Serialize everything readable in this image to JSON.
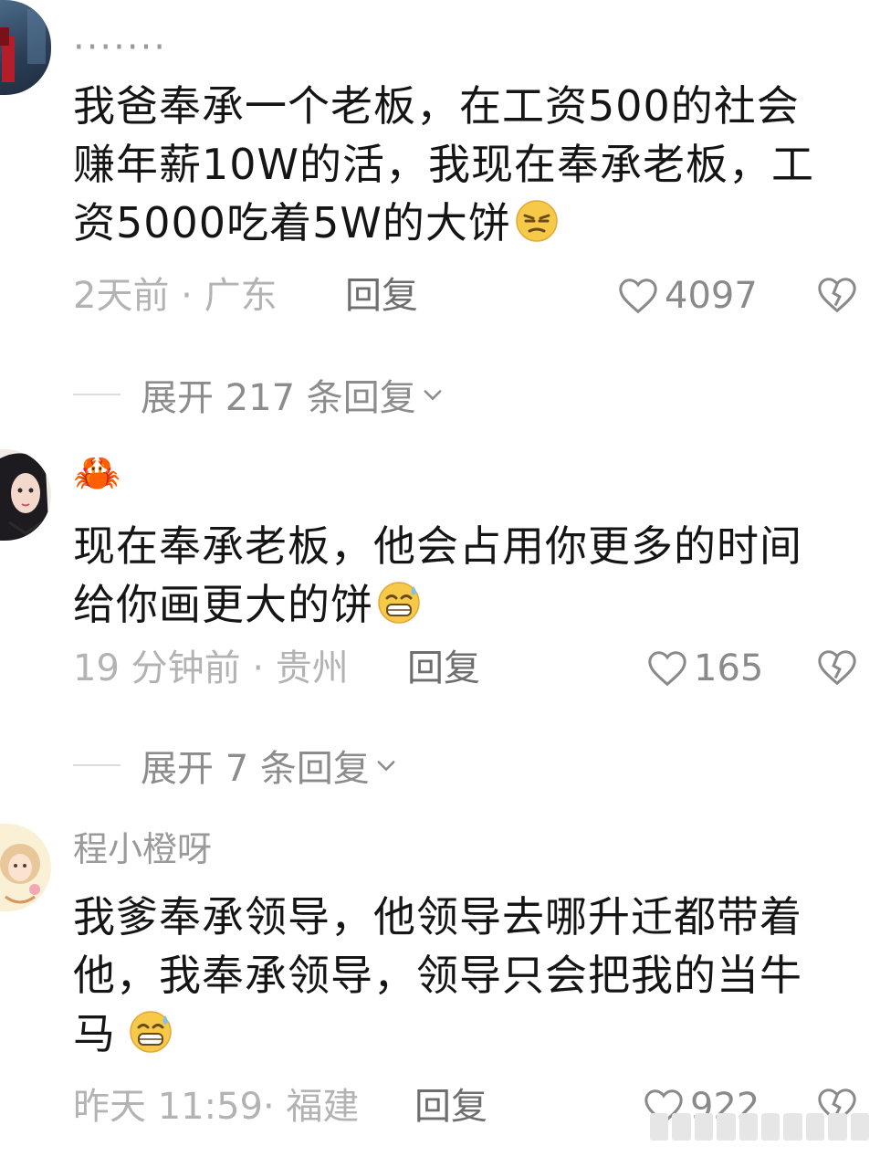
{
  "comments": [
    {
      "username": "·······",
      "text": "我爸奉承一个老板，在工资500的社会赚年薪10W的活，我现在奉承老板，工资5000吃着5W的大饼",
      "emoji": "unamused-face",
      "time_location": "2天前 · 广东",
      "reply_label": "回复",
      "likes": "4097",
      "expand_label": "展开 217 条回复"
    },
    {
      "username": "🦀",
      "text": "现在奉承老板，他会占用你更多的时间给你画更大的饼",
      "emoji": "grinning-sweat-face",
      "time_location": "19 分钟前 · 贵州",
      "reply_label": "回复",
      "likes": "165",
      "expand_label": "展开 7 条回复"
    },
    {
      "username": "程小橙呀",
      "text": "我爹奉承领导，他领导去哪升迁都带着他，我奉承领导，领导只会把我的当牛马",
      "emoji": "grinning-sweat-face",
      "time_location": "昨天 11:59· 福建",
      "reply_label": "回复",
      "likes": "922"
    }
  ],
  "colors": {
    "meta_gray": "#b3b3b3",
    "reply_gray": "#6e6e6e",
    "emoji_yellow": "#f7c948"
  }
}
